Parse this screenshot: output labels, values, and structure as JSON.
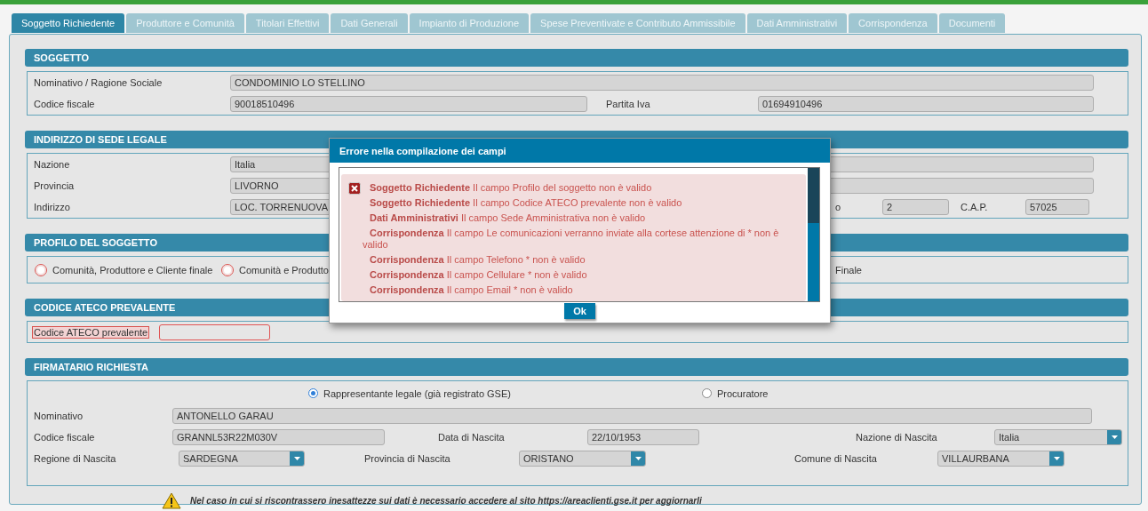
{
  "tabs": [
    {
      "label": "Soggetto Richiedente",
      "selected": true
    },
    {
      "label": "Produttore e Comunità",
      "selected": false
    },
    {
      "label": "Titolari Effettivi",
      "selected": false
    },
    {
      "label": "Dati Generali",
      "selected": false
    },
    {
      "label": "Impianto di Produzione",
      "selected": false
    },
    {
      "label": "Spese Preventivate e Contributo Ammissibile",
      "selected": false
    },
    {
      "label": "Dati Amministrativi",
      "selected": false
    },
    {
      "label": "Corrispondenza",
      "selected": false
    },
    {
      "label": "Documenti",
      "selected": false
    }
  ],
  "sections": [
    {
      "title": "SOGGETTO",
      "rows": [
        {
          "items": [
            {
              "kind": "label",
              "text": "Nominativo / Ragione Sociale"
            },
            {
              "kind": "field",
              "value": "CONDOMINIO LO STELLINO"
            }
          ]
        },
        {
          "items": [
            {
              "kind": "label",
              "text": "Codice fiscale"
            },
            {
              "kind": "field",
              "value": "90018510496"
            },
            {
              "kind": "label",
              "text": "Partita Iva"
            },
            {
              "kind": "field",
              "value": "01694910496"
            }
          ]
        }
      ]
    },
    {
      "title": "INDIRIZZO DI SEDE LEGALE",
      "rows": [
        {
          "items": [
            {
              "kind": "label",
              "text": "Nazione"
            },
            {
              "kind": "field",
              "value": "Italia"
            }
          ]
        },
        {
          "items": [
            {
              "kind": "label",
              "text": "Provincia"
            },
            {
              "kind": "field",
              "value": "LIVORNO"
            }
          ]
        },
        {
          "items": [
            {
              "kind": "label",
              "text": "Indirizzo"
            },
            {
              "kind": "field",
              "value": "LOC. TORRENUOVA"
            },
            {
              "kind": "label",
              "text": "o"
            },
            {
              "kind": "field",
              "value": "2"
            },
            {
              "kind": "label",
              "text": "C.A.P."
            },
            {
              "kind": "field",
              "value": "57025"
            }
          ]
        }
      ]
    },
    {
      "title": "PROFILO DEL SOGGETTO",
      "rows": [
        {
          "items": [
            {
              "kind": "radio",
              "text": "Comunità, Produttore e Cliente finale",
              "selected": false,
              "error": true
            },
            {
              "kind": "radio",
              "text": "Comunità e Produtto",
              "selected": false,
              "error": true
            },
            {
              "kind": "label",
              "text": "Finale"
            }
          ]
        }
      ]
    },
    {
      "title": "CODICE ATECO PREVALENTE",
      "rows": [
        {
          "items": [
            {
              "kind": "label",
              "text": "Codice ATECO prevalente",
              "error": true
            },
            {
              "kind": "field",
              "value": "",
              "error": true
            }
          ]
        }
      ]
    },
    {
      "title": "FIRMATARIO RICHIESTA",
      "rows": [
        {
          "items": [
            {
              "kind": "radio",
              "text": "Rappresentante legale (già registrato GSE)",
              "selected": true
            },
            {
              "kind": "radio",
              "text": "Procuratore",
              "selected": false
            }
          ]
        },
        {
          "items": [
            {
              "kind": "label",
              "text": "Nominativo"
            },
            {
              "kind": "field",
              "value": "ANTONELLO GARAU"
            }
          ]
        },
        {
          "items": [
            {
              "kind": "label",
              "text": "Codice fiscale"
            },
            {
              "kind": "field",
              "value": "GRANNL53R22M030V"
            },
            {
              "kind": "label",
              "text": "Data di Nascita"
            },
            {
              "kind": "field",
              "value": "22/10/1953"
            },
            {
              "kind": "label",
              "text": "Nazione di Nascita"
            },
            {
              "kind": "select",
              "value": "Italia"
            }
          ]
        },
        {
          "items": [
            {
              "kind": "label",
              "text": "Regione di Nascita"
            },
            {
              "kind": "select",
              "value": "SARDEGNA"
            },
            {
              "kind": "label",
              "text": "Provincia di Nascita"
            },
            {
              "kind": "select",
              "value": "ORISTANO"
            },
            {
              "kind": "label",
              "text": "Comune di Nascita"
            },
            {
              "kind": "select",
              "value": "VILLAURBANA"
            }
          ]
        }
      ]
    }
  ],
  "warning": {
    "text": "Nel caso in cui si riscontrassero inesattezze sui dati è necessario accedere al sito https://areaclienti.gse.it per aggiornarli"
  },
  "dialog": {
    "title": "Errore nella compilazione dei campi",
    "errors": [
      "**Soggetto Richiedente** Il campo Profilo del soggetto non è valido",
      "**Soggetto Richiedente** Il campo Codice ATECO prevalente non è valido",
      "**Dati Amministrativi** Il campo Sede Amministrativa non è valido",
      "**Corrispondenza** Il campo Le comunicazioni verranno inviate alla cortese attenzione di * non è valido",
      "**Corrispondenza** Il campo Telefono * non è valido",
      "**Corrispondenza** Il campo Cellulare * non è valido",
      "**Corrispondenza** Il campo Email * non è valido"
    ],
    "button": "Ok"
  }
}
